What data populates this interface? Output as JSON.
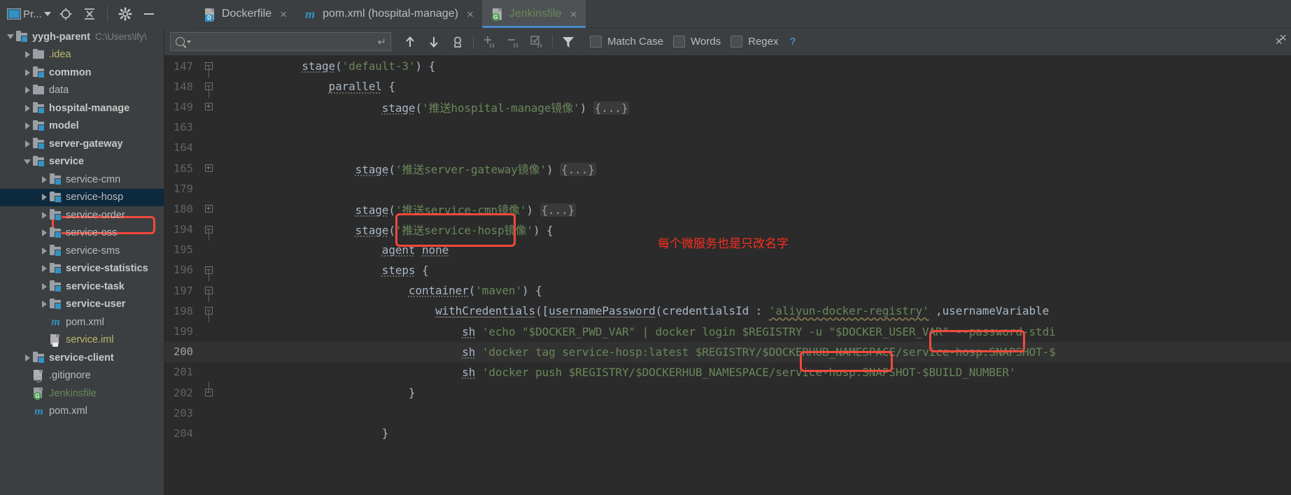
{
  "window": {
    "project_toolbar": {
      "project_label": "Pr...",
      "icons": [
        "project-chip-icon",
        "caret-down-icon",
        "locate-target-icon",
        "collapse-all-icon",
        "settings-gear-icon",
        "hide-minimize-icon"
      ]
    }
  },
  "tabs": [
    {
      "label": "Dockerfile",
      "icon": "dockerfile-icon",
      "badge": "D",
      "active": false,
      "closable": true,
      "color": "plain"
    },
    {
      "label": "pom.xml (hospital-manage)",
      "icon": "maven-icon",
      "badge": "",
      "active": false,
      "closable": true,
      "color": "plain"
    },
    {
      "label": "Jenkinsfile",
      "icon": "groovy-file-icon",
      "badge": "G",
      "active": true,
      "closable": true,
      "color": "green"
    }
  ],
  "sidebar": {
    "items": [
      {
        "label": "yygh-parent",
        "suffix": "C:\\Users\\lfy\\",
        "indent": 0,
        "arrow": "down",
        "icon": "module-folder-icon",
        "style": "bold",
        "selected": false
      },
      {
        "label": ".idea",
        "suffix": "",
        "indent": 1,
        "arrow": "right",
        "icon": "folder-icon",
        "style": "olive",
        "selected": false
      },
      {
        "label": "common",
        "suffix": "",
        "indent": 1,
        "arrow": "right",
        "icon": "module-folder-icon",
        "style": "bold",
        "selected": false
      },
      {
        "label": "data",
        "suffix": "",
        "indent": 1,
        "arrow": "right",
        "icon": "folder-icon",
        "style": "plain",
        "selected": false
      },
      {
        "label": "hospital-manage",
        "suffix": "",
        "indent": 1,
        "arrow": "right",
        "icon": "module-folder-icon",
        "style": "bold",
        "selected": false
      },
      {
        "label": "model",
        "suffix": "",
        "indent": 1,
        "arrow": "right",
        "icon": "module-folder-icon",
        "style": "bold",
        "selected": false
      },
      {
        "label": "server-gateway",
        "suffix": "",
        "indent": 1,
        "arrow": "right",
        "icon": "module-folder-icon",
        "style": "bold",
        "selected": false
      },
      {
        "label": "service",
        "suffix": "",
        "indent": 1,
        "arrow": "down",
        "icon": "module-folder-icon",
        "style": "bold",
        "selected": false
      },
      {
        "label": "service-cmn",
        "suffix": "",
        "indent": 2,
        "arrow": "right",
        "icon": "module-folder-icon",
        "style": "plain",
        "selected": false
      },
      {
        "label": "service-hosp",
        "suffix": "",
        "indent": 2,
        "arrow": "right",
        "icon": "module-folder-icon",
        "style": "plain",
        "selected": true
      },
      {
        "label": "service-order",
        "suffix": "",
        "indent": 2,
        "arrow": "right",
        "icon": "module-folder-icon",
        "style": "plain",
        "selected": false
      },
      {
        "label": "service-oss",
        "suffix": "",
        "indent": 2,
        "arrow": "right",
        "icon": "module-folder-icon",
        "style": "plain",
        "selected": false
      },
      {
        "label": "service-sms",
        "suffix": "",
        "indent": 2,
        "arrow": "right",
        "icon": "module-folder-icon",
        "style": "plain",
        "selected": false
      },
      {
        "label": "service-statistics",
        "suffix": "",
        "indent": 2,
        "arrow": "right",
        "icon": "module-folder-icon",
        "style": "bold",
        "selected": false
      },
      {
        "label": "service-task",
        "suffix": "",
        "indent": 2,
        "arrow": "right",
        "icon": "module-folder-icon",
        "style": "bold",
        "selected": false
      },
      {
        "label": "service-user",
        "suffix": "",
        "indent": 2,
        "arrow": "right",
        "icon": "module-folder-icon",
        "style": "bold",
        "selected": false
      },
      {
        "label": "pom.xml",
        "suffix": "",
        "indent": 2,
        "arrow": "none",
        "icon": "maven-icon",
        "style": "plain",
        "selected": false
      },
      {
        "label": "service.iml",
        "suffix": "",
        "indent": 2,
        "arrow": "none",
        "icon": "iml-file-icon",
        "style": "olive",
        "selected": false
      },
      {
        "label": "service-client",
        "suffix": "",
        "indent": 1,
        "arrow": "right",
        "icon": "module-folder-icon",
        "style": "bold",
        "selected": false
      },
      {
        "label": ".gitignore",
        "suffix": "",
        "indent": 1,
        "arrow": "none",
        "icon": "gitignore-file-icon",
        "style": "plain",
        "selected": false
      },
      {
        "label": "Jenkinsfile",
        "suffix": "",
        "indent": 1,
        "arrow": "none",
        "icon": "groovy-file-icon",
        "style": "green",
        "selected": false
      },
      {
        "label": "pom.xml",
        "suffix": "",
        "indent": 1,
        "arrow": "none",
        "icon": "maven-icon",
        "style": "plain",
        "selected": false
      }
    ]
  },
  "findbar": {
    "search_value": "",
    "search_placeholder": "",
    "buttons": [
      {
        "name": "find-previous-button",
        "glyph": "↑"
      },
      {
        "name": "find-next-button",
        "glyph": "↓"
      },
      {
        "name": "find-all-button",
        "glyph": "⚲"
      },
      {
        "name": "select-all-occurrences-button",
        "glyph": "+"
      },
      {
        "name": "remove-occurrence-button",
        "glyph": "−"
      },
      {
        "name": "select-all-button",
        "glyph": "☑"
      },
      {
        "name": "filter-button",
        "glyph": "▼"
      }
    ],
    "match_case_label": "Match Case",
    "words_label": "Words",
    "regex_label": "Regex",
    "help_label": "?",
    "close_label": "×"
  },
  "editor": {
    "lines": [
      {
        "num": "147",
        "fold": "minus",
        "indent": 3,
        "current": false,
        "tokens": [
          {
            "t": "stage",
            "c": "fn"
          },
          {
            "t": "(",
            "c": "punct"
          },
          {
            "t": "'default-3'",
            "c": "str"
          },
          {
            "t": ") {",
            "c": "punct"
          }
        ]
      },
      {
        "num": "148",
        "fold": "minus",
        "indent": 4,
        "current": false,
        "tokens": [
          {
            "t": "parallel",
            "c": "fn"
          },
          {
            "t": " {",
            "c": "punct"
          }
        ]
      },
      {
        "num": "149",
        "fold": "plus",
        "indent": 6,
        "current": false,
        "tokens": [
          {
            "t": "stage",
            "c": "fn"
          },
          {
            "t": "(",
            "c": "punct"
          },
          {
            "t": "'推送hospital-manage镜像'",
            "c": "str"
          },
          {
            "t": ") ",
            "c": "punct"
          },
          {
            "t": "{...}",
            "c": "fold-ph"
          }
        ]
      },
      {
        "num": "163",
        "fold": "none",
        "indent": 0,
        "current": false,
        "tokens": []
      },
      {
        "num": "164",
        "fold": "none",
        "indent": 0,
        "current": false,
        "tokens": []
      },
      {
        "num": "165",
        "fold": "plus",
        "indent": 5,
        "current": false,
        "tokens": [
          {
            "t": "stage",
            "c": "fn"
          },
          {
            "t": "(",
            "c": "punct"
          },
          {
            "t": "'推送server-gateway镜像'",
            "c": "str"
          },
          {
            "t": ") ",
            "c": "punct"
          },
          {
            "t": "{...}",
            "c": "fold-ph"
          }
        ]
      },
      {
        "num": "179",
        "fold": "none",
        "indent": 0,
        "current": false,
        "tokens": []
      },
      {
        "num": "180",
        "fold": "plus",
        "indent": 5,
        "current": false,
        "tokens": [
          {
            "t": "stage",
            "c": "fn"
          },
          {
            "t": "(",
            "c": "punct"
          },
          {
            "t": "'推送service-cmn镜像'",
            "c": "str"
          },
          {
            "t": ") ",
            "c": "punct"
          },
          {
            "t": "{...}",
            "c": "fold-ph"
          }
        ]
      },
      {
        "num": "194",
        "fold": "minus",
        "indent": 5,
        "current": false,
        "tokens": [
          {
            "t": "stage",
            "c": "fn"
          },
          {
            "t": "(",
            "c": "punct"
          },
          {
            "t": "'推送service-hosp镜像'",
            "c": "str"
          },
          {
            "t": ") {",
            "c": "punct"
          }
        ]
      },
      {
        "num": "195",
        "fold": "none",
        "indent": 6,
        "current": false,
        "tokens": [
          {
            "t": "agent",
            "c": "fn"
          },
          {
            "t": " ",
            "c": "punct"
          },
          {
            "t": "none",
            "c": "fn"
          }
        ]
      },
      {
        "num": "196",
        "fold": "minus",
        "indent": 6,
        "current": false,
        "tokens": [
          {
            "t": "steps",
            "c": "fn"
          },
          {
            "t": " {",
            "c": "punct"
          }
        ]
      },
      {
        "num": "197",
        "fold": "minus",
        "indent": 7,
        "current": false,
        "tokens": [
          {
            "t": "container",
            "c": "fn"
          },
          {
            "t": "(",
            "c": "punct"
          },
          {
            "t": "'maven'",
            "c": "str"
          },
          {
            "t": ") {",
            "c": "punct"
          }
        ]
      },
      {
        "num": "198",
        "fold": "minus",
        "indent": 8,
        "current": false,
        "tokens": [
          {
            "t": "withCredentials",
            "c": "fn2"
          },
          {
            "t": "([",
            "c": "punct"
          },
          {
            "t": "usernamePassword",
            "c": "fn2"
          },
          {
            "t": "(credentialsId : ",
            "c": "punct"
          },
          {
            "t": "'aliyun-docker-registry'",
            "c": "strwarn"
          },
          {
            "t": " ,usernameVariable",
            "c": "punct"
          }
        ]
      },
      {
        "num": "199",
        "fold": "none",
        "indent": 9,
        "current": false,
        "tokens": [
          {
            "t": "sh",
            "c": "fn"
          },
          {
            "t": " ",
            "c": "punct"
          },
          {
            "t": "'echo \"$DOCKER_PWD_VAR\" | docker login $REGISTRY -u \"$DOCKER_USER_VAR\" --password-stdi",
            "c": "str"
          }
        ]
      },
      {
        "num": "200",
        "fold": "none",
        "indent": 9,
        "current": true,
        "tokens": [
          {
            "t": "sh",
            "c": "fn"
          },
          {
            "t": " ",
            "c": "punct"
          },
          {
            "t": "'docker tag service-hosp:latest $REGISTRY/$DOCKERHUB_NAMESPACE/service-hosp:SNAPSHOT-$",
            "c": "str"
          }
        ]
      },
      {
        "num": "201",
        "fold": "none",
        "indent": 9,
        "current": false,
        "tokens": [
          {
            "t": "sh",
            "c": "fn"
          },
          {
            "t": " ",
            "c": "punct"
          },
          {
            "t": "'docker push $REGISTRY/$DOCKERHUB_NAMESPACE/service-hosp:SNAPSHOT-$BUILD_NUMBER'",
            "c": "str"
          }
        ]
      },
      {
        "num": "202",
        "fold": "minus-end",
        "indent": 7,
        "current": false,
        "tokens": [
          {
            "t": "}",
            "c": "punct"
          }
        ]
      },
      {
        "num": "203",
        "fold": "none",
        "indent": 0,
        "current": false,
        "tokens": []
      },
      {
        "num": "204",
        "fold": "none",
        "indent": 6,
        "current": false,
        "tokens": [
          {
            "t": "}",
            "c": "punct"
          }
        ]
      }
    ],
    "annotation_text": "每个微服务也是只改名字"
  },
  "colors": {
    "accent_blue": "#4a88c7",
    "annotation_red": "#ff2d1f",
    "highlight_box_red": "#f4483c",
    "string_green": "#6a8759",
    "selection_blue": "#0d293e",
    "editor_bg": "#2b2b2b",
    "chrome_bg": "#3c3f41"
  }
}
